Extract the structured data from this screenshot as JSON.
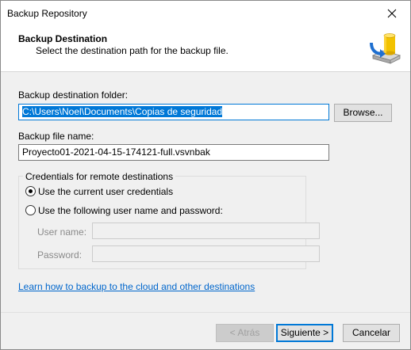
{
  "window": {
    "title": "Backup Repository",
    "close_icon": "close-icon"
  },
  "header": {
    "title": "Backup Destination",
    "subtitle": "Select the destination path for the backup file.",
    "icon": "database-backup-icon"
  },
  "folder": {
    "label": "Backup destination folder:",
    "value": "C:\\Users\\Noel\\Documents\\Copias de seguridad",
    "browse_label": "Browse..."
  },
  "file": {
    "label": "Backup file name:",
    "value": "Proyecto01-2021-04-15-174121-full.vsvnbak"
  },
  "credentials": {
    "group_title": "Credentials for remote destinations",
    "option_current": "Use the current user credentials",
    "option_custom": "Use the following user name and password:",
    "selected": "current",
    "username_label": "User name:",
    "username_value": "",
    "password_label": "Password:",
    "password_value": ""
  },
  "learn_link": "Learn how to backup to the cloud and other destinations",
  "footer": {
    "back_label": "< Atrás",
    "next_label": "Siguiente >",
    "cancel_label": "Cancelar"
  },
  "colors": {
    "accent": "#0078d7",
    "link": "#0066cc"
  }
}
